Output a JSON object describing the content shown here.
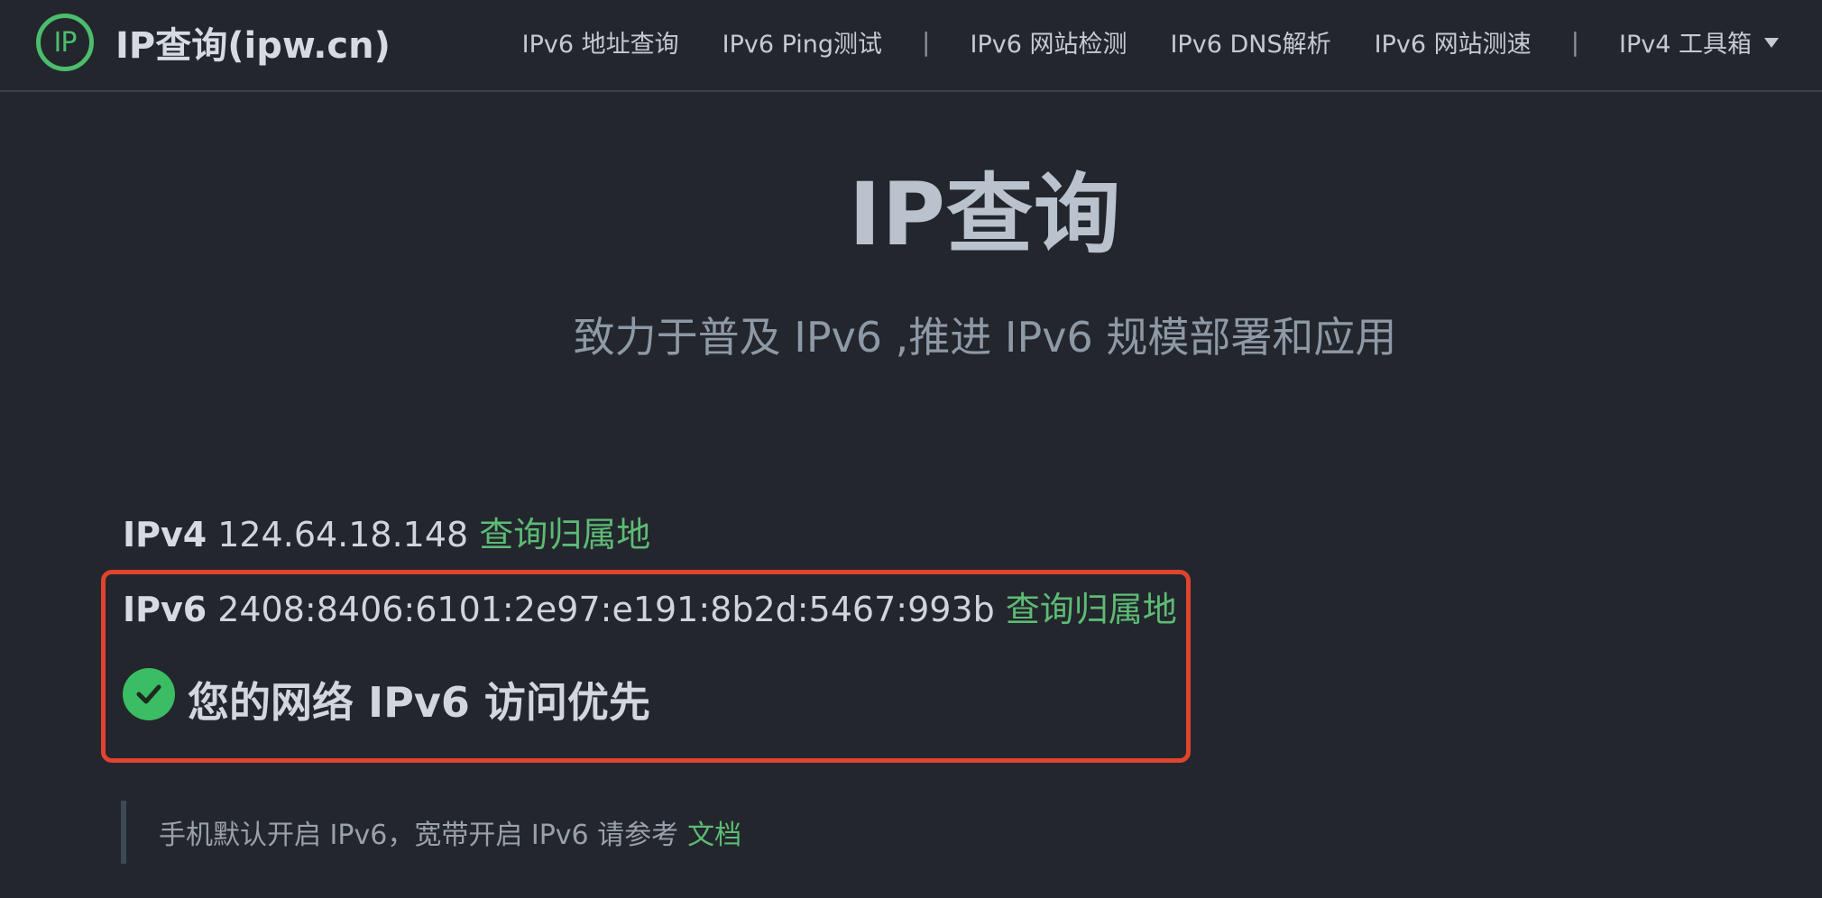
{
  "brand": {
    "logo_text": "IP",
    "name": "IP查询(ipw.cn)"
  },
  "nav": {
    "links": [
      "IPv6 地址查询",
      "IPv6 Ping测试",
      "IPv6 网站检测",
      "IPv6 DNS解析",
      "IPv6 网站测速",
      "IPv4 工具箱"
    ],
    "separator": "|"
  },
  "hero": {
    "title": "IP查询",
    "subtitle": "致力于普及 IPv6 ,推进 IPv6 规模部署和应用"
  },
  "ipv4": {
    "label": "IPv4",
    "address": "124.64.18.148",
    "lookup_link": "查询归属地"
  },
  "ipv6": {
    "label": "IPv6",
    "address": "2408:8406:6101:2e97:e191:8b2d:5467:993b",
    "lookup_link": "查询归属地"
  },
  "status": {
    "icon": "check-circle-icon",
    "text": "您的网络 IPv6 访问优先"
  },
  "note": {
    "text": "手机默认开启 IPv6，宽带开启 IPv6 请参考",
    "link": "文档"
  },
  "colors": {
    "background": "#23262d",
    "accent_green": "#5dbb75",
    "highlight_border": "#e0442e"
  }
}
